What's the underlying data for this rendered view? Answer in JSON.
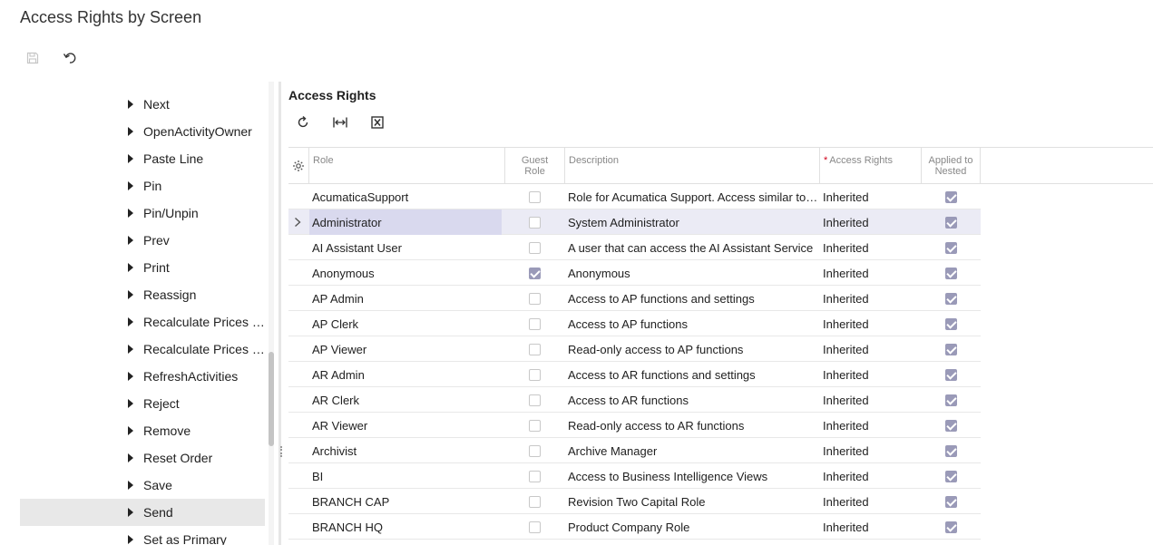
{
  "page": {
    "title": "Access Rights by Screen"
  },
  "toolbar": {
    "save_icon": "save-icon",
    "undo_icon": "undo-icon"
  },
  "tree": {
    "items": [
      {
        "label": "Next"
      },
      {
        "label": "OpenActivityOwner"
      },
      {
        "label": "Paste Line"
      },
      {
        "label": "Pin"
      },
      {
        "label": "Pin/Unpin"
      },
      {
        "label": "Prev"
      },
      {
        "label": "Print"
      },
      {
        "label": "Reassign"
      },
      {
        "label": "Recalculate Prices (All Lines)"
      },
      {
        "label": "Recalculate Prices (r..."
      },
      {
        "label": "RefreshActivities"
      },
      {
        "label": "Reject"
      },
      {
        "label": "Remove"
      },
      {
        "label": "Reset Order"
      },
      {
        "label": "Save"
      },
      {
        "label": "Send"
      },
      {
        "label": "Set as Primary"
      }
    ],
    "selected": "Send"
  },
  "access_rights": {
    "title": "Access Rights",
    "tools": [
      "refresh-icon",
      "fit-columns-icon",
      "export-excel-icon"
    ],
    "columns": {
      "role": "Role",
      "guest_line1": "Guest",
      "guest_line2": "Role",
      "description": "Description",
      "access_rights": "Access Rights",
      "nested_line1": "Applied to",
      "nested_line2": "Nested"
    },
    "rows": [
      {
        "role": "AcumaticaSupport",
        "guest": false,
        "description": "Role for Acumatica Support. Access similar to Administrator",
        "rights": "Inherited",
        "nested": true
      },
      {
        "role": "Administrator",
        "guest": false,
        "description": "System Administrator",
        "rights": "Inherited",
        "nested": true
      },
      {
        "role": "AI Assistant User",
        "guest": false,
        "description": "A user that can access the AI Assistant Service",
        "rights": "Inherited",
        "nested": true
      },
      {
        "role": "Anonymous",
        "guest": true,
        "description": "Anonymous",
        "rights": "Inherited",
        "nested": true
      },
      {
        "role": "AP Admin",
        "guest": false,
        "description": "Access to AP functions and settings",
        "rights": "Inherited",
        "nested": true
      },
      {
        "role": "AP Clerk",
        "guest": false,
        "description": "Access to AP functions",
        "rights": "Inherited",
        "nested": true
      },
      {
        "role": "AP Viewer",
        "guest": false,
        "description": "Read-only access to AP functions",
        "rights": "Inherited",
        "nested": true
      },
      {
        "role": "AR Admin",
        "guest": false,
        "description": "Access to AR functions and settings",
        "rights": "Inherited",
        "nested": true
      },
      {
        "role": "AR Clerk",
        "guest": false,
        "description": "Access to AR functions",
        "rights": "Inherited",
        "nested": true
      },
      {
        "role": "AR Viewer",
        "guest": false,
        "description": "Read-only access to AR functions",
        "rights": "Inherited",
        "nested": true
      },
      {
        "role": "Archivist",
        "guest": false,
        "description": "Archive Manager",
        "rights": "Inherited",
        "nested": true
      },
      {
        "role": "BI",
        "guest": false,
        "description": "Access to Business Intelligence Views",
        "rights": "Inherited",
        "nested": true
      },
      {
        "role": "BRANCH CAP",
        "guest": false,
        "description": "Revision Two Capital Role",
        "rights": "Inherited",
        "nested": true
      },
      {
        "role": "BRANCH HQ",
        "guest": false,
        "description": "Product Company Role",
        "rights": "Inherited",
        "nested": true
      }
    ],
    "selected_row": "Administrator"
  }
}
